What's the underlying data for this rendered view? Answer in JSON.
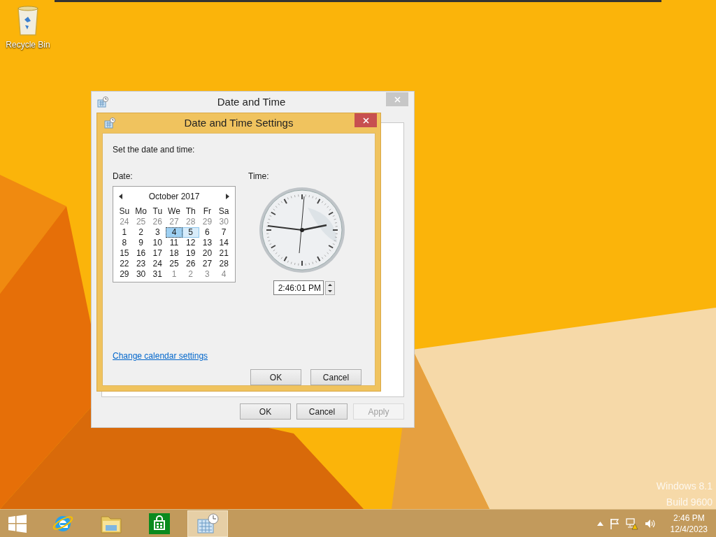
{
  "desktop": {
    "icons": [
      {
        "label": "Recycle Bin"
      }
    ],
    "watermark": [
      "Windows 8.1",
      "Build 9600"
    ]
  },
  "outer_dialog": {
    "title": "Date and Time",
    "buttons": [
      {
        "label": "OK",
        "disabled": false
      },
      {
        "label": "Cancel",
        "disabled": false
      },
      {
        "label": "Apply",
        "disabled": true
      }
    ]
  },
  "dialog": {
    "title": "Date and Time Settings",
    "instruction": "Set the date and time:",
    "date_label": "Date:",
    "time_label": "Time:",
    "calendar": {
      "month": "October 2017",
      "weekdays": [
        "Su",
        "Mo",
        "Tu",
        "We",
        "Th",
        "Fr",
        "Sa"
      ],
      "weeks": [
        [
          {
            "day": "24",
            "muted": true,
            "selected": false,
            "hover": false
          },
          {
            "day": "25",
            "muted": true,
            "selected": false,
            "hover": false
          },
          {
            "day": "26",
            "muted": true,
            "selected": false,
            "hover": false
          },
          {
            "day": "27",
            "muted": true,
            "selected": false,
            "hover": false
          },
          {
            "day": "28",
            "muted": true,
            "selected": false,
            "hover": false
          },
          {
            "day": "29",
            "muted": true,
            "selected": false,
            "hover": false
          },
          {
            "day": "30",
            "muted": true,
            "selected": false,
            "hover": false
          }
        ],
        [
          {
            "day": "1",
            "muted": false,
            "selected": false,
            "hover": false
          },
          {
            "day": "2",
            "muted": false,
            "selected": false,
            "hover": false
          },
          {
            "day": "3",
            "muted": false,
            "selected": false,
            "hover": false
          },
          {
            "day": "4",
            "muted": false,
            "selected": true,
            "hover": false
          },
          {
            "day": "5",
            "muted": false,
            "selected": false,
            "hover": true
          },
          {
            "day": "6",
            "muted": false,
            "selected": false,
            "hover": false
          },
          {
            "day": "7",
            "muted": false,
            "selected": false,
            "hover": false
          }
        ],
        [
          {
            "day": "8",
            "muted": false,
            "selected": false,
            "hover": false
          },
          {
            "day": "9",
            "muted": false,
            "selected": false,
            "hover": false
          },
          {
            "day": "10",
            "muted": false,
            "selected": false,
            "hover": false
          },
          {
            "day": "11",
            "muted": false,
            "selected": false,
            "hover": false
          },
          {
            "day": "12",
            "muted": false,
            "selected": false,
            "hover": false
          },
          {
            "day": "13",
            "muted": false,
            "selected": false,
            "hover": false
          },
          {
            "day": "14",
            "muted": false,
            "selected": false,
            "hover": false
          }
        ],
        [
          {
            "day": "15",
            "muted": false,
            "selected": false,
            "hover": false
          },
          {
            "day": "16",
            "muted": false,
            "selected": false,
            "hover": false
          },
          {
            "day": "17",
            "muted": false,
            "selected": false,
            "hover": false
          },
          {
            "day": "18",
            "muted": false,
            "selected": false,
            "hover": false
          },
          {
            "day": "19",
            "muted": false,
            "selected": false,
            "hover": false
          },
          {
            "day": "20",
            "muted": false,
            "selected": false,
            "hover": false
          },
          {
            "day": "21",
            "muted": false,
            "selected": false,
            "hover": false
          }
        ],
        [
          {
            "day": "22",
            "muted": false,
            "selected": false,
            "hover": false
          },
          {
            "day": "23",
            "muted": false,
            "selected": false,
            "hover": false
          },
          {
            "day": "24",
            "muted": false,
            "selected": false,
            "hover": false
          },
          {
            "day": "25",
            "muted": false,
            "selected": false,
            "hover": false
          },
          {
            "day": "26",
            "muted": false,
            "selected": false,
            "hover": false
          },
          {
            "day": "27",
            "muted": false,
            "selected": false,
            "hover": false
          },
          {
            "day": "28",
            "muted": false,
            "selected": false,
            "hover": false
          }
        ],
        [
          {
            "day": "29",
            "muted": false,
            "selected": false,
            "hover": false
          },
          {
            "day": "30",
            "muted": false,
            "selected": false,
            "hover": false
          },
          {
            "day": "31",
            "muted": false,
            "selected": false,
            "hover": false
          },
          {
            "day": "1",
            "muted": true,
            "selected": false,
            "hover": false
          },
          {
            "day": "2",
            "muted": true,
            "selected": false,
            "hover": false
          },
          {
            "day": "3",
            "muted": true,
            "selected": false,
            "hover": false
          },
          {
            "day": "4",
            "muted": true,
            "selected": false,
            "hover": false
          }
        ]
      ]
    },
    "time_value": "2:46:01 PM",
    "link": "Change calendar settings",
    "buttons": [
      {
        "label": "OK"
      },
      {
        "label": "Cancel"
      }
    ]
  },
  "taskbar": {
    "apps": [
      {
        "kind": "ie",
        "selected": false
      },
      {
        "kind": "explorer",
        "selected": false
      },
      {
        "kind": "store",
        "selected": false
      },
      {
        "kind": "datetime",
        "selected": true
      }
    ],
    "time": "2:46 PM",
    "date": "12/4/2023"
  }
}
